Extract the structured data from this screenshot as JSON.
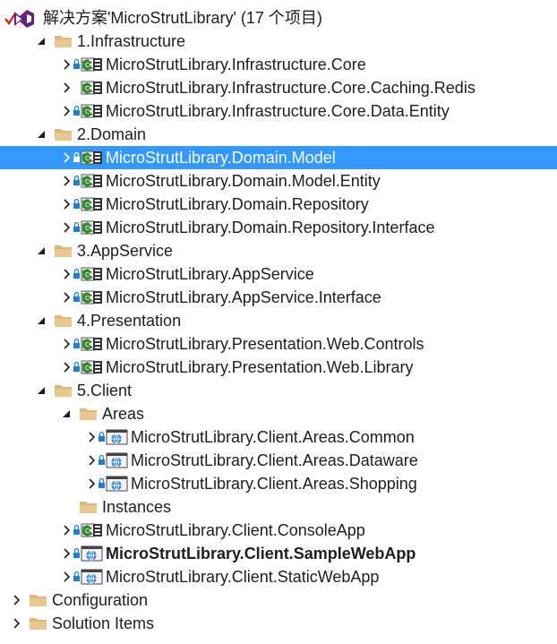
{
  "solution": {
    "title": "解决方案'MicroStrutLibrary' (17 个项目)"
  },
  "colors": {
    "selection": "#3399ff",
    "folder": "#dcb67a",
    "csharp": "#388a34",
    "web": "#1e7fd0",
    "vs_purple": "#68217a",
    "check_red": "#e51400",
    "text": "#1e1e1e"
  },
  "rows": [
    {
      "label": "1.Infrastructure",
      "icon": "folder-icon",
      "expander": "expanded"
    },
    {
      "label": "MicroStrutLibrary.Infrastructure.Core",
      "icon": "csharp-project-icon",
      "lock": true,
      "expander": "collapsed"
    },
    {
      "label": "MicroStrutLibrary.Infrastructure.Core.Caching.Redis",
      "icon": "csharp-project-icon",
      "lock": false,
      "expander": "collapsed"
    },
    {
      "label": "MicroStrutLibrary.Infrastructure.Core.Data.Entity",
      "icon": "csharp-project-icon",
      "lock": true,
      "expander": "collapsed"
    },
    {
      "label": "2.Domain",
      "icon": "folder-icon",
      "expander": "expanded"
    },
    {
      "label": "MicroStrutLibrary.Domain.Model",
      "icon": "csharp-project-icon",
      "lock": true,
      "expander": "collapsed",
      "selected": true
    },
    {
      "label": "MicroStrutLibrary.Domain.Model.Entity",
      "icon": "csharp-project-icon",
      "lock": true,
      "expander": "collapsed"
    },
    {
      "label": "MicroStrutLibrary.Domain.Repository",
      "icon": "csharp-project-icon",
      "lock": true,
      "expander": "collapsed"
    },
    {
      "label": "MicroStrutLibrary.Domain.Repository.Interface",
      "icon": "csharp-project-icon",
      "lock": true,
      "expander": "collapsed"
    },
    {
      "label": "3.AppService",
      "icon": "folder-icon",
      "expander": "expanded"
    },
    {
      "label": "MicroStrutLibrary.AppService",
      "icon": "csharp-project-icon",
      "lock": true,
      "expander": "collapsed"
    },
    {
      "label": "MicroStrutLibrary.AppService.Interface",
      "icon": "csharp-project-icon",
      "lock": true,
      "expander": "collapsed"
    },
    {
      "label": "4.Presentation",
      "icon": "folder-icon",
      "expander": "expanded"
    },
    {
      "label": "MicroStrutLibrary.Presentation.Web.Controls",
      "icon": "csharp-project-icon",
      "lock": true,
      "expander": "collapsed"
    },
    {
      "label": "MicroStrutLibrary.Presentation.Web.Library",
      "icon": "csharp-project-icon",
      "lock": true,
      "expander": "collapsed"
    },
    {
      "label": "5.Client",
      "icon": "folder-icon",
      "expander": "expanded"
    },
    {
      "label": "Areas",
      "icon": "folder-icon",
      "expander": "expanded"
    },
    {
      "label": "MicroStrutLibrary.Client.Areas.Common",
      "icon": "web-project-icon",
      "lock": true,
      "expander": "collapsed"
    },
    {
      "label": "MicroStrutLibrary.Client.Areas.Dataware",
      "icon": "web-project-icon",
      "lock": true,
      "expander": "collapsed"
    },
    {
      "label": "MicroStrutLibrary.Client.Areas.Shopping",
      "icon": "web-project-icon",
      "lock": true,
      "expander": "collapsed"
    },
    {
      "label": "Instances",
      "icon": "folder-icon",
      "expander": "none"
    },
    {
      "label": "MicroStrutLibrary.Client.ConsoleApp",
      "icon": "csharp-project-icon",
      "lock": true,
      "expander": "collapsed"
    },
    {
      "label": "MicroStrutLibrary.Client.SampleWebApp",
      "icon": "web-project-icon",
      "lock": true,
      "expander": "collapsed",
      "bold": true
    },
    {
      "label": "MicroStrutLibrary.Client.StaticWebApp",
      "icon": "web-project-icon",
      "lock": true,
      "expander": "collapsed"
    },
    {
      "label": "Configuration",
      "icon": "folder-icon",
      "expander": "collapsed"
    },
    {
      "label": "Solution Items",
      "icon": "folder-icon",
      "expander": "collapsed"
    }
  ]
}
